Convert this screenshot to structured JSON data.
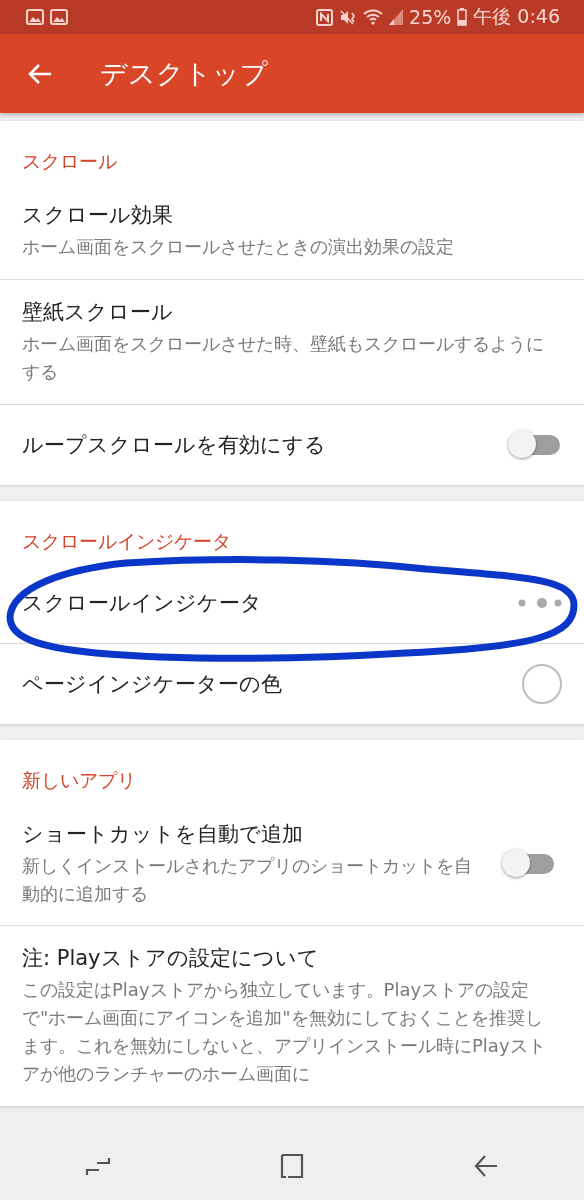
{
  "status_bar": {
    "battery": "25%",
    "time": "午後 0:46"
  },
  "app_bar": {
    "title": "デスクトップ"
  },
  "sections": [
    {
      "header": "スクロール",
      "items": [
        {
          "kind": "detail",
          "title": "スクロール効果",
          "summary": "ホーム画面をスクロールさせたときの演出効果の設定"
        },
        {
          "kind": "detail",
          "title": "壁紙スクロール",
          "summary": "ホーム画面をスクロールさせた時、壁紙もスクロールするようにする"
        },
        {
          "kind": "switch",
          "title": "ループスクロールを有効にする",
          "on": false
        }
      ]
    },
    {
      "header": "スクロールインジケータ",
      "items": [
        {
          "kind": "indicator",
          "title": "スクロールインジケータ"
        },
        {
          "kind": "swatch",
          "title": "ページインジケーターの色"
        }
      ]
    },
    {
      "header": "新しいアプリ",
      "items": [
        {
          "kind": "switch",
          "title": "ショートカットを自動で追加",
          "summary": "新しくインストールされたアプリのショートカットを自動的に追加する",
          "on": false
        },
        {
          "kind": "detail",
          "title": "注: Playストアの設定について",
          "summary": "この設定はPlayストアから独立しています。Playストアの設定で\"ホーム画面にアイコンを追加\"を無効にしておくことを推奨します。これを無効にしないと、アプリインストール時にPlayストアが他のランチャーのホーム画面に"
        }
      ]
    }
  ]
}
